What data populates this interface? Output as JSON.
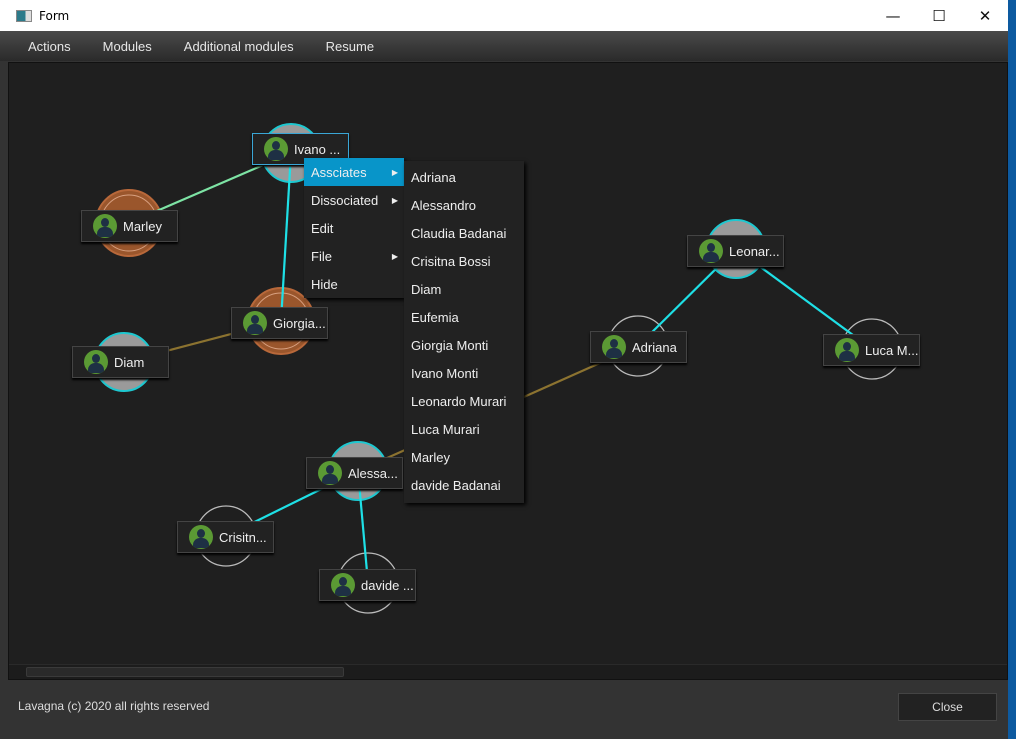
{
  "window": {
    "title": "Form",
    "minimize": "—",
    "maximize": "☐",
    "close": "✕"
  },
  "menubar": [
    "Actions",
    "Modules",
    "Additional modules",
    "Resume"
  ],
  "graph": {
    "nodes": [
      {
        "id": "ivano",
        "label": "Ivano ...",
        "style": "gray",
        "selected": true
      },
      {
        "id": "marley",
        "label": "Marley",
        "style": "brown"
      },
      {
        "id": "giorgia",
        "label": "Giorgia...",
        "style": "brown"
      },
      {
        "id": "diam",
        "label": "Diam",
        "style": "gray"
      },
      {
        "id": "leonardo",
        "label": "Leonar...",
        "style": "gray"
      },
      {
        "id": "adriana",
        "label": "Adriana",
        "style": "outline"
      },
      {
        "id": "luca",
        "label": "Luca M...",
        "style": "outline"
      },
      {
        "id": "alessandro",
        "label": "Alessa...",
        "style": "gray"
      },
      {
        "id": "crisitna",
        "label": "Crisitn...",
        "style": "outline"
      },
      {
        "id": "davide",
        "label": "davide ...",
        "style": "outline"
      }
    ],
    "edges": [
      {
        "from": "ivano",
        "to": "marley",
        "color": "#7de3a4"
      },
      {
        "from": "ivano",
        "to": "giorgia",
        "color": "#1ee0e6"
      },
      {
        "from": "giorgia",
        "to": "diam",
        "color": "#8c7330"
      },
      {
        "from": "leonardo",
        "to": "adriana",
        "color": "#1ee0e6"
      },
      {
        "from": "leonardo",
        "to": "luca",
        "color": "#1ee0e6"
      },
      {
        "from": "adriana",
        "to": "alessandro",
        "color": "#8c7330"
      },
      {
        "from": "alessandro",
        "to": "crisitna",
        "color": "#1ee0e6"
      },
      {
        "from": "alessandro",
        "to": "davide",
        "color": "#1ee0e6"
      }
    ]
  },
  "context_menu": {
    "items": [
      {
        "label": "Assciates",
        "submenu": true,
        "active": true
      },
      {
        "label": "Dissociated",
        "submenu": true
      },
      {
        "label": "Edit"
      },
      {
        "label": "File",
        "submenu": true
      },
      {
        "label": "Hide"
      }
    ]
  },
  "submenu": [
    "Adriana",
    "Alessandro",
    "Claudia Badanai",
    "Crisitna Bossi",
    "Diam",
    "Eufemia",
    "Giorgia Monti",
    "Ivano Monti",
    "Leonardo Murari",
    "Luca Murari",
    "Marley",
    "davide Badanai"
  ],
  "footer": {
    "status": "Lavagna (c) 2020 all rights reserved",
    "close": "Close"
  }
}
